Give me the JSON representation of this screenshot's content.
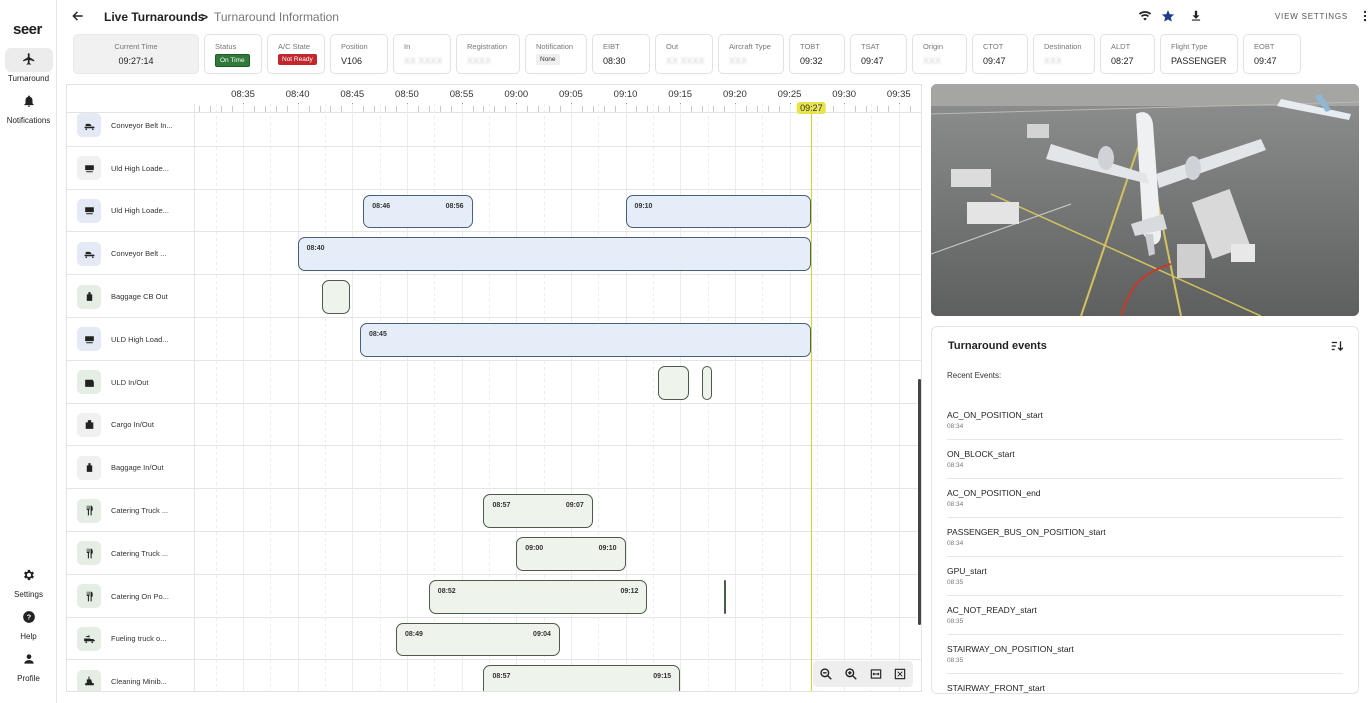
{
  "brand": "seer",
  "nav": {
    "items": [
      {
        "label": "Turnaround",
        "icon": "plane-icon"
      },
      {
        "label": "Notifications",
        "icon": "bell-icon"
      }
    ],
    "bottom": [
      {
        "label": "Settings",
        "icon": "gear-icon"
      },
      {
        "label": "Help",
        "icon": "help-icon"
      },
      {
        "label": "Profile",
        "icon": "person-icon"
      }
    ]
  },
  "header": {
    "crumb1": "Live Turnarounds",
    "separator": ">",
    "crumb2": "Turnaround Information",
    "view_settings": "VIEW SETTINGS"
  },
  "infobar": [
    {
      "label": "Current Time",
      "value": "09:27:14",
      "kind": "time"
    },
    {
      "label": "Status",
      "value": "On Time",
      "kind": "pill-green"
    },
    {
      "label": "A/C State",
      "value": "Not Ready",
      "kind": "pill-red"
    },
    {
      "label": "Position",
      "value": "V106"
    },
    {
      "label": "In",
      "value": "XX XXXX",
      "kind": "blur"
    },
    {
      "label": "Registration",
      "value": "XXXX",
      "kind": "blur"
    },
    {
      "label": "Notification",
      "value": "None",
      "kind": "pill-grey"
    },
    {
      "label": "EIBT",
      "value": "08:30"
    },
    {
      "label": "Out",
      "value": "XX XXXX",
      "kind": "blur"
    },
    {
      "label": "Aircraft Type",
      "value": "XXX",
      "kind": "blur"
    },
    {
      "label": "TOBT",
      "value": "09:32"
    },
    {
      "label": "TSAT",
      "value": "09:47"
    },
    {
      "label": "Origin",
      "value": "XXX",
      "kind": "blur"
    },
    {
      "label": "CTOT",
      "value": "09:47"
    },
    {
      "label": "Destination",
      "value": "XXX",
      "kind": "blur"
    },
    {
      "label": "ALDT",
      "value": "08:27"
    },
    {
      "label": "Flight Type",
      "value": "PASSENGER"
    },
    {
      "label": "EOBT",
      "value": "09:47"
    }
  ],
  "timeline": {
    "ticks": [
      "08:35",
      "08:40",
      "08:45",
      "08:50",
      "08:55",
      "09:00",
      "09:05",
      "09:10",
      "09:15",
      "09:20",
      "09:25",
      "09:30",
      "09:35"
    ],
    "now": "09:27",
    "rows": [
      {
        "name": "Conveyor Belt In...",
        "icon": "conveyor-icon",
        "tone": "blue",
        "bars": []
      },
      {
        "name": "Uld High Loade...",
        "icon": "loader-icon",
        "tone": "grey",
        "bars": []
      },
      {
        "name": "Uld High Loade...",
        "icon": "loader-icon",
        "tone": "blue",
        "bars": [
          {
            "start": "08:46",
            "end": "08:56",
            "tone": "blue",
            "labelStart": "08:46",
            "labelEnd": "08:56"
          },
          {
            "start": "09:10",
            "end": "09:27",
            "tone": "blue",
            "labelStart": "09:10",
            "labelEnd": ""
          }
        ]
      },
      {
        "name": "Conveyor Belt ...",
        "icon": "conveyor-icon",
        "tone": "blue",
        "bars": [
          {
            "start": "08:40",
            "end": "09:27",
            "tone": "blue",
            "labelStart": "08:40",
            "labelEnd": ""
          }
        ]
      },
      {
        "name": "Baggage CB Out",
        "icon": "baggage-icon",
        "tone": "green",
        "bars": [
          {
            "start": "08:42.2",
            "end": "08:44.8",
            "tone": "green",
            "labelStart": "",
            "labelEnd": ""
          }
        ]
      },
      {
        "name": "ULD High Load...",
        "icon": "loader-icon",
        "tone": "blue",
        "bars": [
          {
            "start": "08:45.7",
            "end": "09:27",
            "tone": "blue",
            "labelStart": "08:45",
            "labelEnd": ""
          }
        ]
      },
      {
        "name": "ULD In/Out",
        "icon": "uld-icon",
        "tone": "green",
        "bars": [
          {
            "start": "09:13",
            "end": "09:15.8",
            "tone": "green",
            "labelStart": "",
            "labelEnd": ""
          },
          {
            "start": "09:17",
            "end": "09:17.9",
            "tone": "green",
            "labelStart": "",
            "labelEnd": ""
          }
        ]
      },
      {
        "name": "Cargo In/Out",
        "icon": "cargo-icon",
        "tone": "grey",
        "bars": []
      },
      {
        "name": "Baggage In/Out",
        "icon": "baggage-icon",
        "tone": "grey",
        "bars": []
      },
      {
        "name": "Catering Truck ...",
        "icon": "catering-icon",
        "tone": "green",
        "bars": [
          {
            "start": "08:57",
            "end": "09:07",
            "tone": "green",
            "labelStart": "08:57",
            "labelEnd": "09:07"
          }
        ]
      },
      {
        "name": "Catering Truck ...",
        "icon": "catering-icon",
        "tone": "green",
        "bars": [
          {
            "start": "09:00",
            "end": "09:10",
            "tone": "green",
            "labelStart": "09:00",
            "labelEnd": "09:10"
          }
        ]
      },
      {
        "name": "Catering On Po...",
        "icon": "catering-icon",
        "tone": "green",
        "bars": [
          {
            "start": "08:52",
            "end": "09:12",
            "tone": "green",
            "labelStart": "08:52",
            "labelEnd": "09:12"
          },
          {
            "start": "09:19",
            "end": "09:19.2",
            "tone": "green",
            "labelStart": "",
            "labelEnd": ""
          }
        ]
      },
      {
        "name": "Fueling truck o...",
        "icon": "fuel-truck-icon",
        "tone": "green",
        "bars": [
          {
            "start": "08:49",
            "end": "09:04",
            "tone": "green",
            "labelStart": "08:49",
            "labelEnd": "09:04"
          }
        ]
      },
      {
        "name": "Cleaning Minib...",
        "icon": "cleaning-icon",
        "tone": "green",
        "bars": [
          {
            "start": "08:57",
            "end": "09:15",
            "tone": "green",
            "labelStart": "08:57",
            "labelEnd": "09:15"
          }
        ]
      }
    ]
  },
  "events": {
    "title": "Turnaround events",
    "subtitle": "Recent Events:",
    "items": [
      {
        "name": "AC_ON_POSITION_start",
        "time": "08:34"
      },
      {
        "name": "ON_BLOCK_start",
        "time": "08:34"
      },
      {
        "name": "AC_ON_POSITION_end",
        "time": "08:34"
      },
      {
        "name": "PASSENGER_BUS_ON_POSITION_start",
        "time": "08:34"
      },
      {
        "name": "GPU_start",
        "time": "08:35"
      },
      {
        "name": "AC_NOT_READY_start",
        "time": "08:35"
      },
      {
        "name": "STAIRWAY_ON_POSITION_start",
        "time": "08:35"
      },
      {
        "name": "STAIRWAY_FRONT_start",
        "time": ""
      }
    ]
  }
}
